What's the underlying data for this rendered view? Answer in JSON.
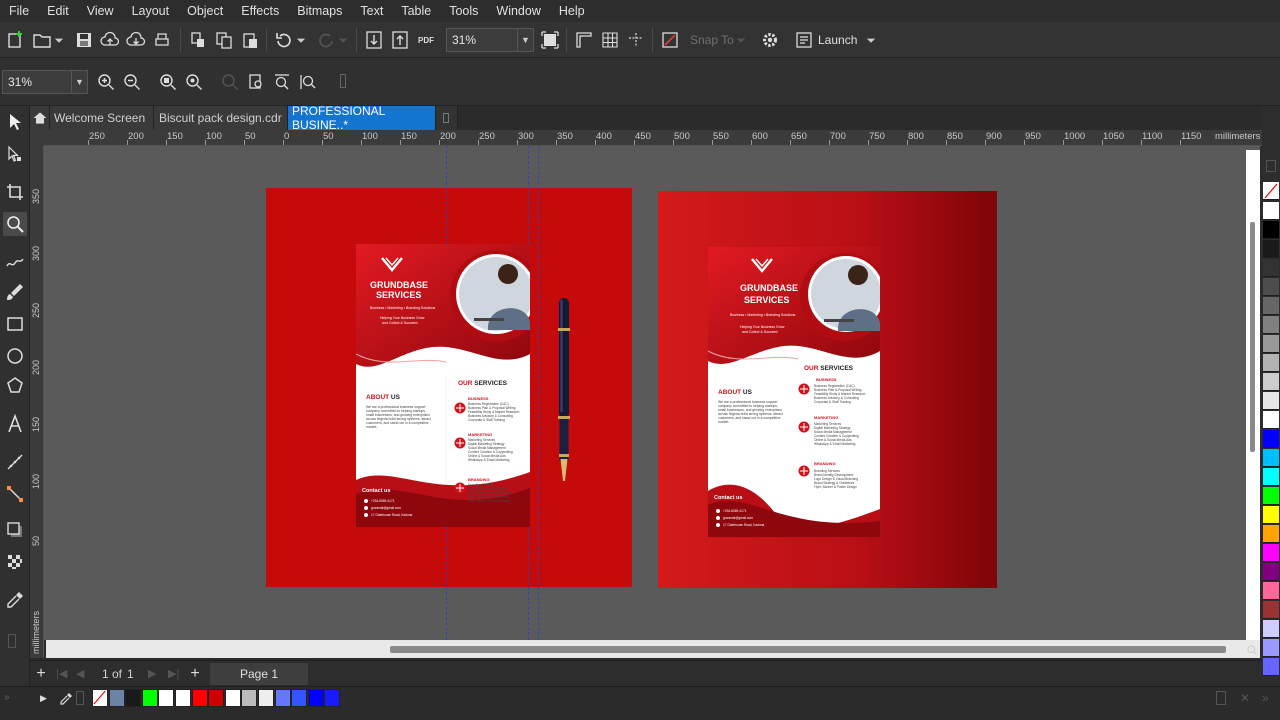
{
  "menu": [
    "File",
    "Edit",
    "View",
    "Layout",
    "Object",
    "Effects",
    "Bitmaps",
    "Text",
    "Table",
    "Tools",
    "Window",
    "Help"
  ],
  "toolbar": {
    "zoom_value": "31%",
    "pdf_label": "PDF",
    "snap_label": "Snap To",
    "launch_label": "Launch"
  },
  "property_bar": {
    "zoom_value": "31%"
  },
  "tabs": {
    "welcome": "Welcome Screen",
    "biscuit": "Biscuit pack design.cdr",
    "professional": "PROFESSIONAL BUSINE..*"
  },
  "ruler": {
    "h_labels": [
      "250",
      "200",
      "150",
      "100",
      "50",
      "0",
      "50",
      "100",
      "150",
      "200",
      "250",
      "300",
      "350",
      "400",
      "450",
      "500",
      "550",
      "600",
      "650",
      "700",
      "750",
      "800",
      "850",
      "900",
      "950",
      "1000",
      "1050",
      "1100",
      "1150"
    ],
    "unit": "millimeters",
    "v_labels": [
      "350",
      "300",
      "250",
      "200",
      "150",
      "100",
      "50"
    ],
    "v_unit": "millimeters"
  },
  "pages": {
    "current": "1",
    "of_label": "of",
    "total": "1",
    "page_tab": "Page 1"
  },
  "flyer": {
    "brand_line1": "GRUNDBASE",
    "brand_line2": "SERVICES",
    "tagline": "Business • Marketing • Branding Solutions",
    "sub_tagline_1": "Helping Your Business Grow",
    "sub_tagline_2": "and Collect & Succeed",
    "about_accent": "ABOUT",
    "about_rest": " US",
    "about_body_1": "We are a professional business support",
    "about_body_2": "company committed to helping startups,",
    "about_body_3": "small businesses, and growing enterprises",
    "about_body_4": "across Nigeria build strong systems, attract",
    "about_body_5": "customers, and stand out in a competitive",
    "about_body_6": "market.",
    "services_accent": "OUR",
    "services_rest": " SERVICES",
    "svc1_title": "BUSINESS",
    "svc1_lines": [
      "Business Registration (CAC)",
      "Business Plan & Proposal Writing",
      "Feasibility Study & Market Research",
      "Business Advisory & Consulting",
      "Corporate & Staff Training"
    ],
    "svc2_title": "MARKETING",
    "svc2_lines": [
      "Marketing Services",
      "Digital Marketing Strategy",
      "Social Media Management",
      "Content Creation & Copywriting",
      "Online & Social Media Ads",
      "WhatsApp & Email Marketing"
    ],
    "svc3_title": "BRANDING",
    "svc3_lines": [
      "Branding Services",
      "Brand Identity Development",
      "Logo Design & Visual Branding",
      "Brand Strategy & Guidelines",
      "Flyer, Banner & Poster Design"
    ],
    "contact_title": "Contact us",
    "contact_phone": "+234-8069-4171",
    "contact_email": "grunmail@gmail.com",
    "contact_address": "17 Gatehouse Road, Kaduna"
  },
  "colors": {
    "accent_blue": "#1475d1",
    "board_red": "#c40a0a",
    "flyer_red": "#d0121b",
    "canvas_gray": "#5a5a5a"
  },
  "palette_right": [
    "#ffffff",
    "#000000",
    "#1a1a1a",
    "#333333",
    "#4d4d4d",
    "#666666",
    "#808080",
    "#999999",
    "#b3b3b3",
    "#cccccc",
    "#e6e6e6",
    "#ffffff",
    "#0000ff",
    "#00bfff",
    "#00ffff",
    "#00ff00",
    "#ffff00",
    "#ffa500",
    "#ff00ff",
    "#800080",
    "#ff6699",
    "#993333",
    "#ccccff",
    "#9999ff",
    "#6666ff"
  ],
  "document_palette": [
    "#ffffff",
    "#6b84a6",
    "#1a1a1a",
    "#00ff00",
    "#ffffff",
    "#ffffff",
    "#ff0000",
    "#cc0000",
    "#ffffff",
    "#bbbbbb",
    "#eeeeee",
    "#6677ff",
    "#3355ff",
    "#0000ff",
    "#1a1aff"
  ]
}
